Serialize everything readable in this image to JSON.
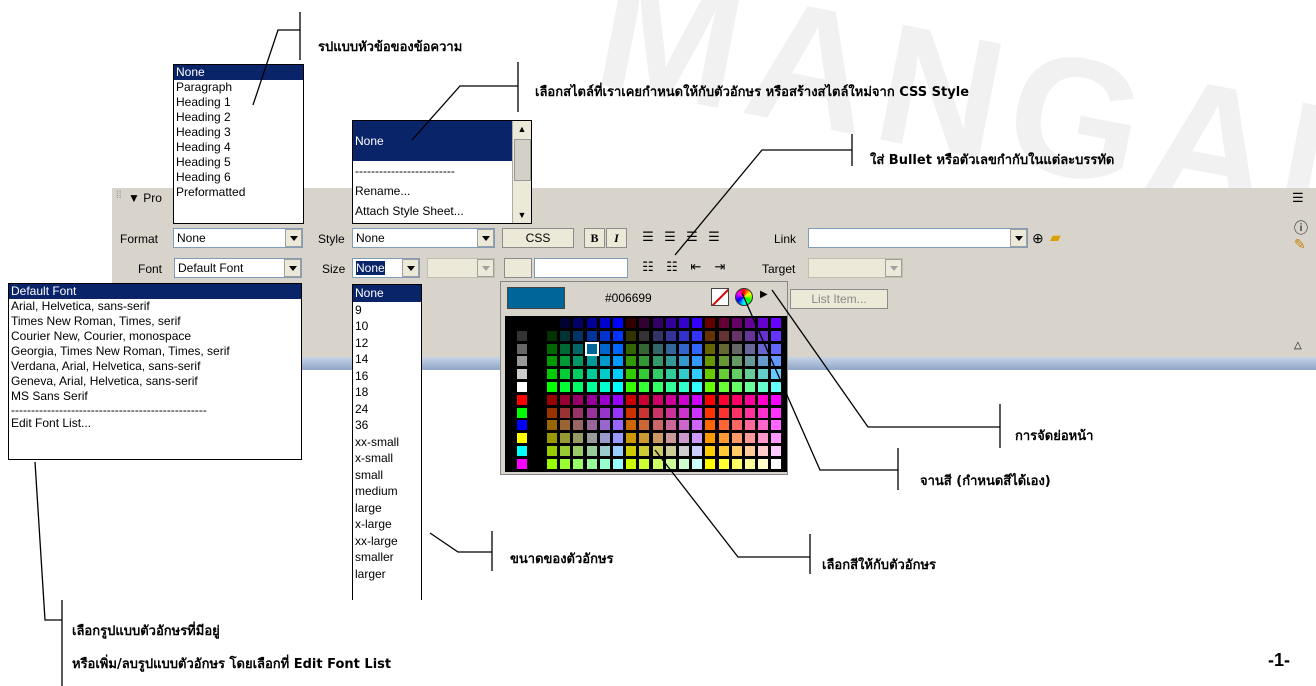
{
  "watermark": "MANGANO",
  "page_number": "-1-",
  "panel": {
    "title": "▼ Pro",
    "format_label": "Format",
    "format_value": "None",
    "font_label": "Font",
    "font_value": "Default Font",
    "style_label": "Style",
    "style_value": "None",
    "size_label": "Size",
    "size_value": "None",
    "css_button": "CSS",
    "bold_button": "B",
    "italic_button": "I",
    "link_label": "Link",
    "link_value": "",
    "target_label": "Target",
    "list_item_button": "List Item...",
    "color_value": ""
  },
  "format_list": {
    "items": [
      "None",
      "Paragraph",
      "Heading 1",
      "Heading 2",
      "Heading 3",
      "Heading 4",
      "Heading 5",
      "Heading 6",
      "Preformatted"
    ],
    "selected_index": 0
  },
  "style_list": {
    "items": [
      "None",
      "-------------------------",
      "Rename...",
      "Attach Style Sheet..."
    ],
    "selected_index": 0
  },
  "font_list": {
    "items": [
      "Default Font",
      "Arial, Helvetica, sans-serif",
      "Times New Roman, Times, serif",
      "Courier New, Courier, monospace",
      "Georgia, Times New Roman, Times, serif",
      "Verdana, Arial, Helvetica, sans-serif",
      "Geneva, Arial, Helvetica, sans-serif",
      "MS Sans Serif"
    ],
    "separator": "-------------------------------------------------",
    "edit_item": "Edit Font List...",
    "selected_index": 0
  },
  "size_list": {
    "items": [
      "None",
      "9",
      "10",
      "12",
      "14",
      "16",
      "18",
      "24",
      "36",
      "xx-small",
      "x-small",
      "small",
      "medium",
      "large",
      "x-large",
      "xx-large",
      "smaller",
      "larger"
    ],
    "selected_index": 0
  },
  "color_picker": {
    "hex_value": "#006699",
    "preview_color": "#006699",
    "selected_color": "#006699"
  },
  "annotations": {
    "heading_format": "รปแบบหัวข้อของข้อความ",
    "style_select": "เลือกสไตล์ที่เราเคยกำหนดให้กับตัวอักษร หรือสร้างสไตล์ใหม่จาก CSS Style",
    "bullet": "ใส่ Bullet หรือตัวเลขกำกับในแต่ละบรรทัด",
    "indent": "การจัดย่อหน้า",
    "palette": "จานสี (กำหนดสีได้เอง)",
    "text_color": "เลือกสีให้กับตัวอักษร",
    "font_size": "ขนาดของตัวอักษร",
    "font_select_line1": "เลือกรูปแบบตัวอักษรที่มีอยู่",
    "font_select_line2": "หรือเพิ่ม/ลบรูปแบบตัวอักษร โดยเลือกที่ Edit Font List"
  }
}
